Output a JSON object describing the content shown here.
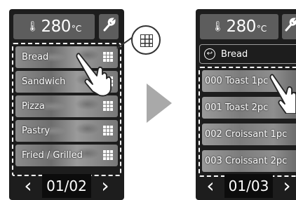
{
  "left_screen": {
    "temperature": {
      "icon": "thermometer-icon",
      "value": "280",
      "unit": "°C"
    },
    "settings_icon": "wrench-icon",
    "categories": [
      {
        "label": "Bread"
      },
      {
        "label": "Sandwich"
      },
      {
        "label": "Pizza"
      },
      {
        "label": "Pastry"
      },
      {
        "label": "Fried / Grilled"
      }
    ],
    "category_icon": "grid-icon",
    "pager": {
      "prev": "‹",
      "page": "01/02",
      "next": "›"
    }
  },
  "callout": {
    "icon": "grid-icon"
  },
  "transition_arrow": "right-arrow-icon",
  "right_screen": {
    "temperature": {
      "icon": "thermometer-icon",
      "value": "280",
      "unit": "°C"
    },
    "settings_icon": "wrench-icon",
    "back": {
      "icon": "back-arrow-icon",
      "label": "Bread"
    },
    "recipes": [
      {
        "label": "000 Toast 1pc"
      },
      {
        "label": "001 Toast 2pc"
      },
      {
        "label": "002 Croissant 1pc"
      },
      {
        "label": "003 Croissant 2pc"
      }
    ],
    "pager": {
      "prev": "‹",
      "page": "01/03",
      "next": "›"
    }
  },
  "colors": {
    "screen_bg": "#1d1d1d",
    "button_bg": "#5d5d5d",
    "arrow": "#a9a9a9"
  }
}
